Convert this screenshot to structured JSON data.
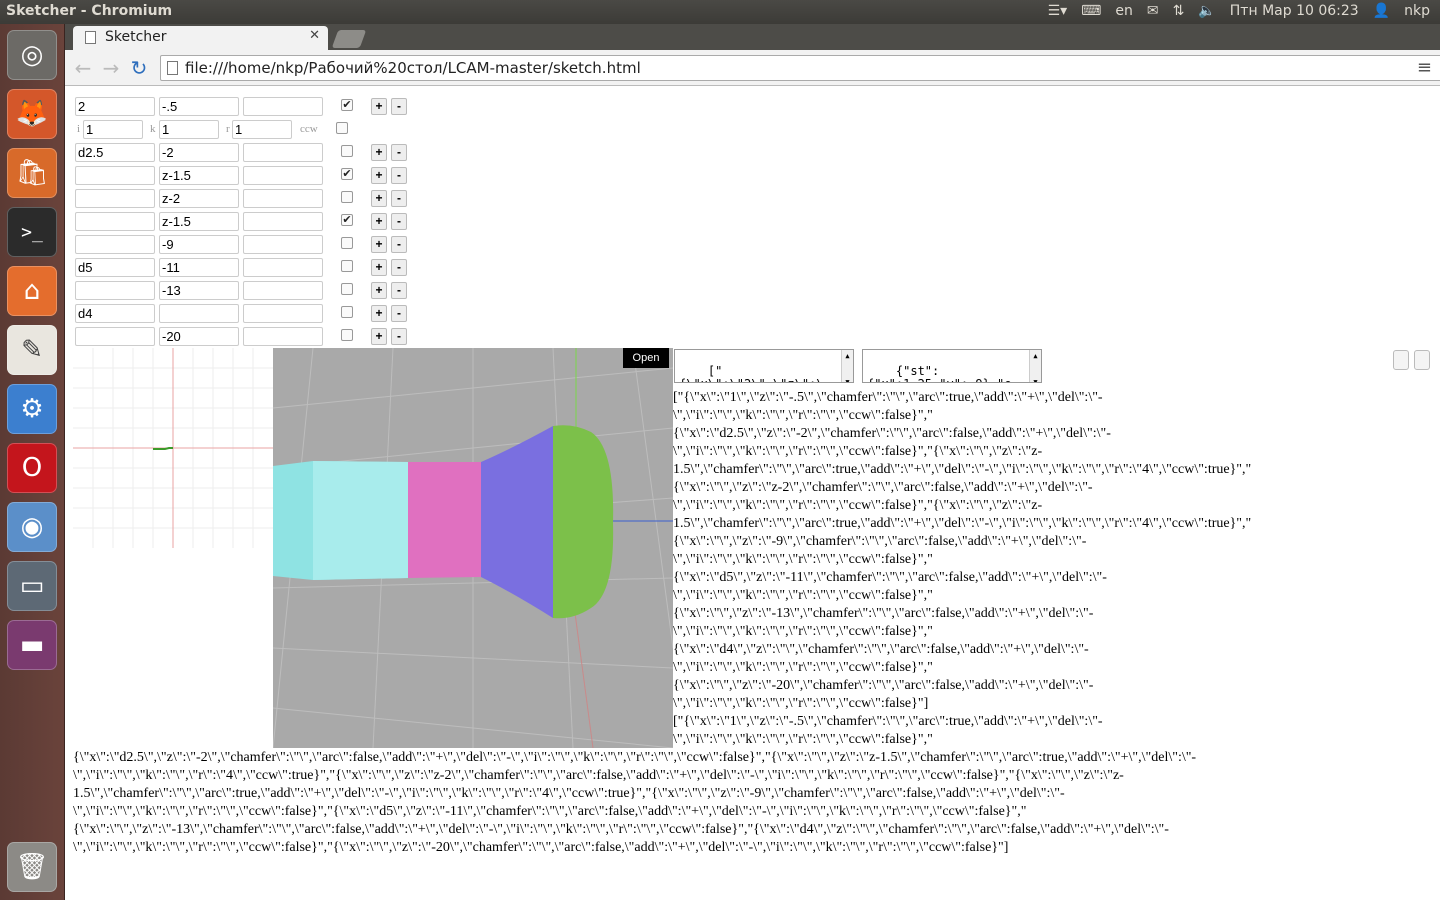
{
  "system_panel": {
    "window_title": "Sketcher - Chromium",
    "keyboard_layout": "en",
    "clock": "Птн Мар 10 06:23",
    "user": "nkp"
  },
  "browser": {
    "tab_title": "Sketcher",
    "url": "file:///home/nkp/Рабочий%20стол/LCAM-master/sketch.html"
  },
  "rows": [
    {
      "x": "2",
      "z": "-.5",
      "chamfer": "",
      "arc": true
    },
    {
      "x": "d2.5",
      "z": "-2",
      "chamfer": "",
      "arc": false
    },
    {
      "x": "",
      "z": "z-1.5",
      "chamfer": "",
      "arc": true
    },
    {
      "x": "",
      "z": "z-2",
      "chamfer": "",
      "arc": false
    },
    {
      "x": "",
      "z": "z-1.5",
      "chamfer": "",
      "arc": true
    },
    {
      "x": "",
      "z": "-9",
      "chamfer": "",
      "arc": false
    },
    {
      "x": "d5",
      "z": "-11",
      "chamfer": "",
      "arc": false
    },
    {
      "x": "",
      "z": "-13",
      "chamfer": "",
      "arc": false
    },
    {
      "x": "d4",
      "z": "",
      "chamfer": "",
      "arc": false
    },
    {
      "x": "",
      "z": "-20",
      "chamfer": "",
      "arc": false
    }
  ],
  "arc_params": {
    "i_label": "i",
    "i_value": "1",
    "k_label": "k",
    "k_value": "1",
    "r_label": "r",
    "r_value": "1",
    "ccw_label": "ccw"
  },
  "row_add_label": "+",
  "row_del_label": "-",
  "open_button_label": "Open",
  "textarea1": "[\"\n{\\\"x\\\":\\\"2\\\",\\\"z\\\":\\",
  "textarea2": "{\"st\":\n{\"x\":1.25,\"y\":-9},\"e",
  "json_out1_lines": [
    "[\"{\\\"x\\\":\\\"1\\\",\\\"z\\\":\\\"-.5\\\",\\\"chamfer\\\":\\\"\\\",\\\"arc\\\":true,\\\"add\\\":\\\"+\\\",\\\"del\\\":\\\"-",
    "\\\",\\\"i\\\":\\\"\\\",\\\"k\\\":\\\"\\\",\\\"r\\\":\\\"\\\",\\\"ccw\\\":false}\",\"",
    "{\\\"x\\\":\\\"d2.5\\\",\\\"z\\\":\\\"-2\\\",\\\"chamfer\\\":\\\"\\\",\\\"arc\\\":false,\\\"add\\\":\\\"+\\\",\\\"del\\\":\\\"-",
    "\\\",\\\"i\\\":\\\"\\\",\\\"k\\\":\\\"\\\",\\\"r\\\":\\\"\\\",\\\"ccw\\\":false}\",\"{\\\"x\\\":\\\"\\\",\\\"z\\\":\\\"z-",
    "1.5\\\",\\\"chamfer\\\":\\\"\\\",\\\"arc\\\":true,\\\"add\\\":\\\"+\\\",\\\"del\\\":\\\"-\\\",\\\"i\\\":\\\"\\\",\\\"k\\\":\\\"\\\",\\\"r\\\":\\\"4\\\",\\\"ccw\\\":true}\",\"",
    "{\\\"x\\\":\\\"\\\",\\\"z\\\":\\\"z-2\\\",\\\"chamfer\\\":\\\"\\\",\\\"arc\\\":false,\\\"add\\\":\\\"+\\\",\\\"del\\\":\\\"-",
    "\\\",\\\"i\\\":\\\"\\\",\\\"k\\\":\\\"\\\",\\\"r\\\":\\\"\\\",\\\"ccw\\\":false}\",\"{\\\"x\\\":\\\"\\\",\\\"z\\\":\\\"z-",
    "1.5\\\",\\\"chamfer\\\":\\\"\\\",\\\"arc\\\":true,\\\"add\\\":\\\"+\\\",\\\"del\\\":\\\"-\\\",\\\"i\\\":\\\"\\\",\\\"k\\\":\\\"\\\",\\\"r\\\":\\\"4\\\",\\\"ccw\\\":true}\",\"",
    "{\\\"x\\\":\\\"\\\",\\\"z\\\":\\\"-9\\\",\\\"chamfer\\\":\\\"\\\",\\\"arc\\\":false,\\\"add\\\":\\\"+\\\",\\\"del\\\":\\\"-",
    "\\\",\\\"i\\\":\\\"\\\",\\\"k\\\":\\\"\\\",\\\"r\\\":\\\"\\\",\\\"ccw\\\":false}\",\"",
    "{\\\"x\\\":\\\"d5\\\",\\\"z\\\":\\\"-11\\\",\\\"chamfer\\\":\\\"\\\",\\\"arc\\\":false,\\\"add\\\":\\\"+\\\",\\\"del\\\":\\\"-",
    "\\\",\\\"i\\\":\\\"\\\",\\\"k\\\":\\\"\\\",\\\"r\\\":\\\"\\\",\\\"ccw\\\":false}\",\"",
    "{\\\"x\\\":\\\"\\\",\\\"z\\\":\\\"-13\\\",\\\"chamfer\\\":\\\"\\\",\\\"arc\\\":false,\\\"add\\\":\\\"+\\\",\\\"del\\\":\\\"-",
    "\\\",\\\"i\\\":\\\"\\\",\\\"k\\\":\\\"\\\",\\\"r\\\":\\\"\\\",\\\"ccw\\\":false}\",\"",
    "{\\\"x\\\":\\\"d4\\\",\\\"z\\\":\\\"\\\",\\\"chamfer\\\":\\\"\\\",\\\"arc\\\":false,\\\"add\\\":\\\"+\\\",\\\"del\\\":\\\"-",
    "\\\",\\\"i\\\":\\\"\\\",\\\"k\\\":\\\"\\\",\\\"r\\\":\\\"\\\",\\\"ccw\\\":false}\",\"",
    "{\\\"x\\\":\\\"\\\",\\\"z\\\":\\\"-20\\\",\\\"chamfer\\\":\\\"\\\",\\\"arc\\\":false,\\\"add\\\":\\\"+\\\",\\\"del\\\":\\\"-",
    "\\\",\\\"i\\\":\\\"\\\",\\\"k\\\":\\\"\\\",\\\"r\\\":\\\"\\\",\\\"ccw\\\":false}\"]",
    "[\"{\\\"x\\\":\\\"1\\\",\\\"z\\\":\\\"-.5\\\",\\\"chamfer\\\":\\\"\\\",\\\"arc\\\":true,\\\"add\\\":\\\"+\\\",\\\"del\\\":\\\"-",
    "\\\",\\\"i\\\":\\\"\\\",\\\"k\\\":\\\"\\\",\\\"r\\\":\\\"\\\",\\\"ccw\\\":false}\",\""
  ],
  "json_out2_lines": [
    "{\\\"x\\\":\\\"d2.5\\\",\\\"z\\\":\\\"-2\\\",\\\"chamfer\\\":\\\"\\\",\\\"arc\\\":false,\\\"add\\\":\\\"+\\\",\\\"del\\\":\\\"-\\\",\\\"i\\\":\\\"\\\",\\\"k\\\":\\\"\\\",\\\"r\\\":\\\"\\\",\\\"ccw\\\":false}\",\"{\\\"x\\\":\\\"\\\",\\\"z\\\":\\\"z-1.5\\\",\\\"chamfer\\\":\\\"\\\",\\\"arc\\\":true,\\\"add\\\":\\\"+\\\",\\\"del\\\":\\\"-",
    "\\\",\\\"i\\\":\\\"\\\",\\\"k\\\":\\\"\\\",\\\"r\\\":\\\"4\\\",\\\"ccw\\\":true}\",\"{\\\"x\\\":\\\"\\\",\\\"z\\\":\\\"z-2\\\",\\\"chamfer\\\":\\\"\\\",\\\"arc\\\":false,\\\"add\\\":\\\"+\\\",\\\"del\\\":\\\"-\\\",\\\"i\\\":\\\"\\\",\\\"k\\\":\\\"\\\",\\\"r\\\":\\\"\\\",\\\"ccw\\\":false}\",\"{\\\"x\\\":\\\"\\\",\\\"z\\\":\\\"z-",
    "1.5\\\",\\\"chamfer\\\":\\\"\\\",\\\"arc\\\":true,\\\"add\\\":\\\"+\\\",\\\"del\\\":\\\"-\\\",\\\"i\\\":\\\"\\\",\\\"k\\\":\\\"\\\",\\\"r\\\":\\\"4\\\",\\\"ccw\\\":true}\",\"{\\\"x\\\":\\\"\\\",\\\"z\\\":\\\"-9\\\",\\\"chamfer\\\":\\\"\\\",\\\"arc\\\":false,\\\"add\\\":\\\"+\\\",\\\"del\\\":\\\"-",
    "\\\",\\\"i\\\":\\\"\\\",\\\"k\\\":\\\"\\\",\\\"r\\\":\\\"\\\",\\\"ccw\\\":false}\",\"{\\\"x\\\":\\\"d5\\\",\\\"z\\\":\\\"-11\\\",\\\"chamfer\\\":\\\"\\\",\\\"arc\\\":false,\\\"add\\\":\\\"+\\\",\\\"del\\\":\\\"-\\\",\\\"i\\\":\\\"\\\",\\\"k\\\":\\\"\\\",\\\"r\\\":\\\"\\\",\\\"ccw\\\":false}\",\"",
    "{\\\"x\\\":\\\"\\\",\\\"z\\\":\\\"-13\\\",\\\"chamfer\\\":\\\"\\\",\\\"arc\\\":false,\\\"add\\\":\\\"+\\\",\\\"del\\\":\\\"-\\\",\\\"i\\\":\\\"\\\",\\\"k\\\":\\\"\\\",\\\"r\\\":\\\"\\\",\\\"ccw\\\":false}\",\"{\\\"x\\\":\\\"d4\\\",\\\"z\\\":\\\"\\\",\\\"chamfer\\\":\\\"\\\",\\\"arc\\\":false,\\\"add\\\":\\\"+\\\",\\\"del\\\":\\\"-",
    "\\\",\\\"i\\\":\\\"\\\",\\\"k\\\":\\\"\\\",\\\"r\\\":\\\"\\\",\\\"ccw\\\":false}\",\"{\\\"x\\\":\\\"\\\",\\\"z\\\":\\\"-20\\\",\\\"chamfer\\\":\\\"\\\",\\\"arc\\\":false,\\\"add\\\":\\\"+\\\",\\\"del\\\":\\\"-\\\",\\\"i\\\":\\\"\\\",\\\"k\\\":\\\"\\\",\\\"r\\\":\\\"\\\",\\\"ccw\\\":false}\"]"
  ],
  "launcher_icons": [
    "ubuntu-dash-icon",
    "firefox-icon",
    "software-center-icon",
    "terminal-icon",
    "files-icon",
    "text-editor-icon",
    "settings-icon",
    "opera-icon",
    "chromium-icon",
    "workspace-switcher-icon",
    "screenshot-icon",
    "trash-icon"
  ],
  "colors": {
    "cyan_segment": "#8fe3e3",
    "pink_segment": "#e070c0",
    "blue_segment": "#7a6fe0",
    "green_segment": "#7cc04a",
    "viewport_bg": "#a9a9a9",
    "launcher_bg": "#5b3a34"
  }
}
